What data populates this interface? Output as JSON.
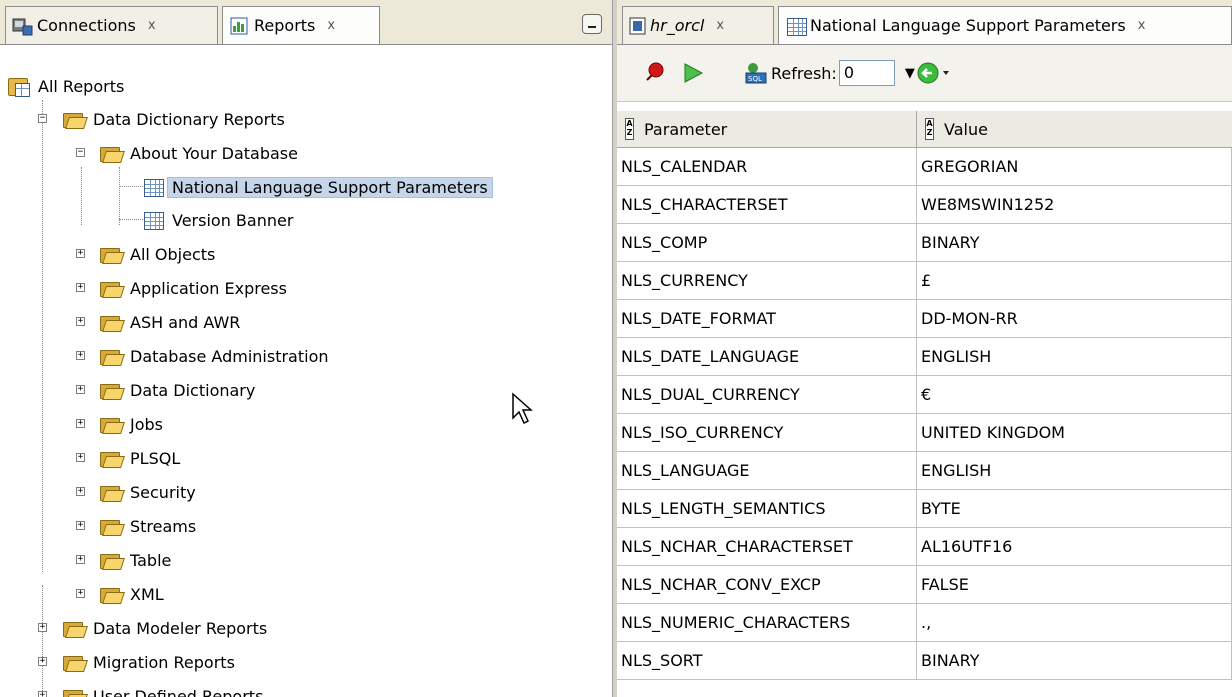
{
  "left_tabs": [
    {
      "label": "Connections",
      "close": "x",
      "icon": "connections-icon"
    },
    {
      "label": "Reports",
      "close": "x",
      "icon": "reports-icon"
    }
  ],
  "right_tabs": [
    {
      "label": "hr_orcl",
      "close": "x",
      "icon": "sql-worksheet-icon"
    },
    {
      "label": "National Language Support Parameters",
      "close": "x",
      "icon": "report-icon"
    }
  ],
  "toolbar": {
    "refresh_label": "Refresh:",
    "refresh_value": "0",
    "icons": [
      "pin-icon",
      "run-icon",
      "sql-icon",
      "back-navigation-icon"
    ]
  },
  "tree": {
    "root": "All Reports",
    "data_dictionary_reports": "Data Dictionary Reports",
    "about_your_database": "About Your Database",
    "nls_params": "National Language Support Parameters",
    "version_banner": "Version Banner",
    "groups": [
      "All Objects",
      "Application Express",
      "ASH and AWR",
      "Database Administration",
      "Data Dictionary",
      "Jobs",
      "PLSQL",
      "Security",
      "Streams",
      "Table",
      "XML"
    ],
    "top_level": [
      "Data Modeler Reports",
      "Migration Reports",
      "User Defined Reports"
    ]
  },
  "grid": {
    "headers": [
      "Parameter",
      "Value"
    ],
    "rows": [
      [
        "NLS_CALENDAR",
        "GREGORIAN"
      ],
      [
        "NLS_CHARACTERSET",
        "WE8MSWIN1252"
      ],
      [
        "NLS_COMP",
        "BINARY"
      ],
      [
        "NLS_CURRENCY",
        "£"
      ],
      [
        "NLS_DATE_FORMAT",
        "DD-MON-RR"
      ],
      [
        "NLS_DATE_LANGUAGE",
        "ENGLISH"
      ],
      [
        "NLS_DUAL_CURRENCY",
        "€"
      ],
      [
        "NLS_ISO_CURRENCY",
        "UNITED KINGDOM"
      ],
      [
        "NLS_LANGUAGE",
        "ENGLISH"
      ],
      [
        "NLS_LENGTH_SEMANTICS",
        "BYTE"
      ],
      [
        "NLS_NCHAR_CHARACTERSET",
        "AL16UTF16"
      ],
      [
        "NLS_NCHAR_CONV_EXCP",
        "FALSE"
      ],
      [
        "NLS_NUMERIC_CHARACTERS",
        ".,"
      ],
      [
        "NLS_SORT",
        "BINARY"
      ]
    ]
  },
  "colors": {
    "selection": "#c6d6ea",
    "chrome": "#ece9d8",
    "folder": "#f6d56c"
  }
}
